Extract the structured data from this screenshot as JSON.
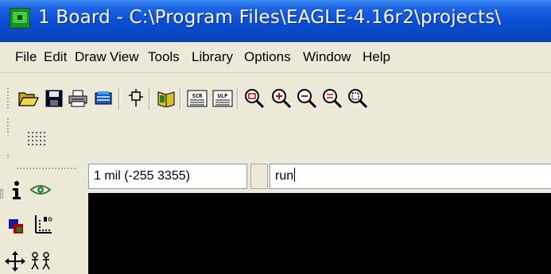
{
  "window": {
    "title": "1 Board - C:\\Program Files\\EAGLE-4.16r2\\projects\\"
  },
  "menu": [
    {
      "label": "File"
    },
    {
      "label": "Edit"
    },
    {
      "label": "Draw"
    },
    {
      "label": "View"
    },
    {
      "label": "Tools"
    },
    {
      "label": "Library"
    },
    {
      "label": "Options"
    },
    {
      "label": "Window"
    },
    {
      "label": "Help"
    }
  ],
  "toolbar": {
    "icons": [
      "open-icon",
      "save-icon",
      "print-icon",
      "cam-processor-icon",
      "schematic-board-switch-icon",
      "library-book-icon",
      "script-icon",
      "ulp-icon",
      "zoom-to-fit-icon",
      "zoom-in-icon",
      "zoom-out-icon",
      "redraw-icon",
      "zoom-select-icon"
    ]
  },
  "command": {
    "coordinates": "1 mil (-255 3355)",
    "input_value": "run"
  },
  "sidebar": {
    "icons": [
      "info-icon",
      "show-eye-icon",
      "display-layers-icon",
      "mark-icon",
      "move-icon",
      "copy-icon"
    ]
  },
  "colors": {
    "titlebar": "#0b4fd6",
    "face": "#ece9d8",
    "canvas": "#000000"
  }
}
